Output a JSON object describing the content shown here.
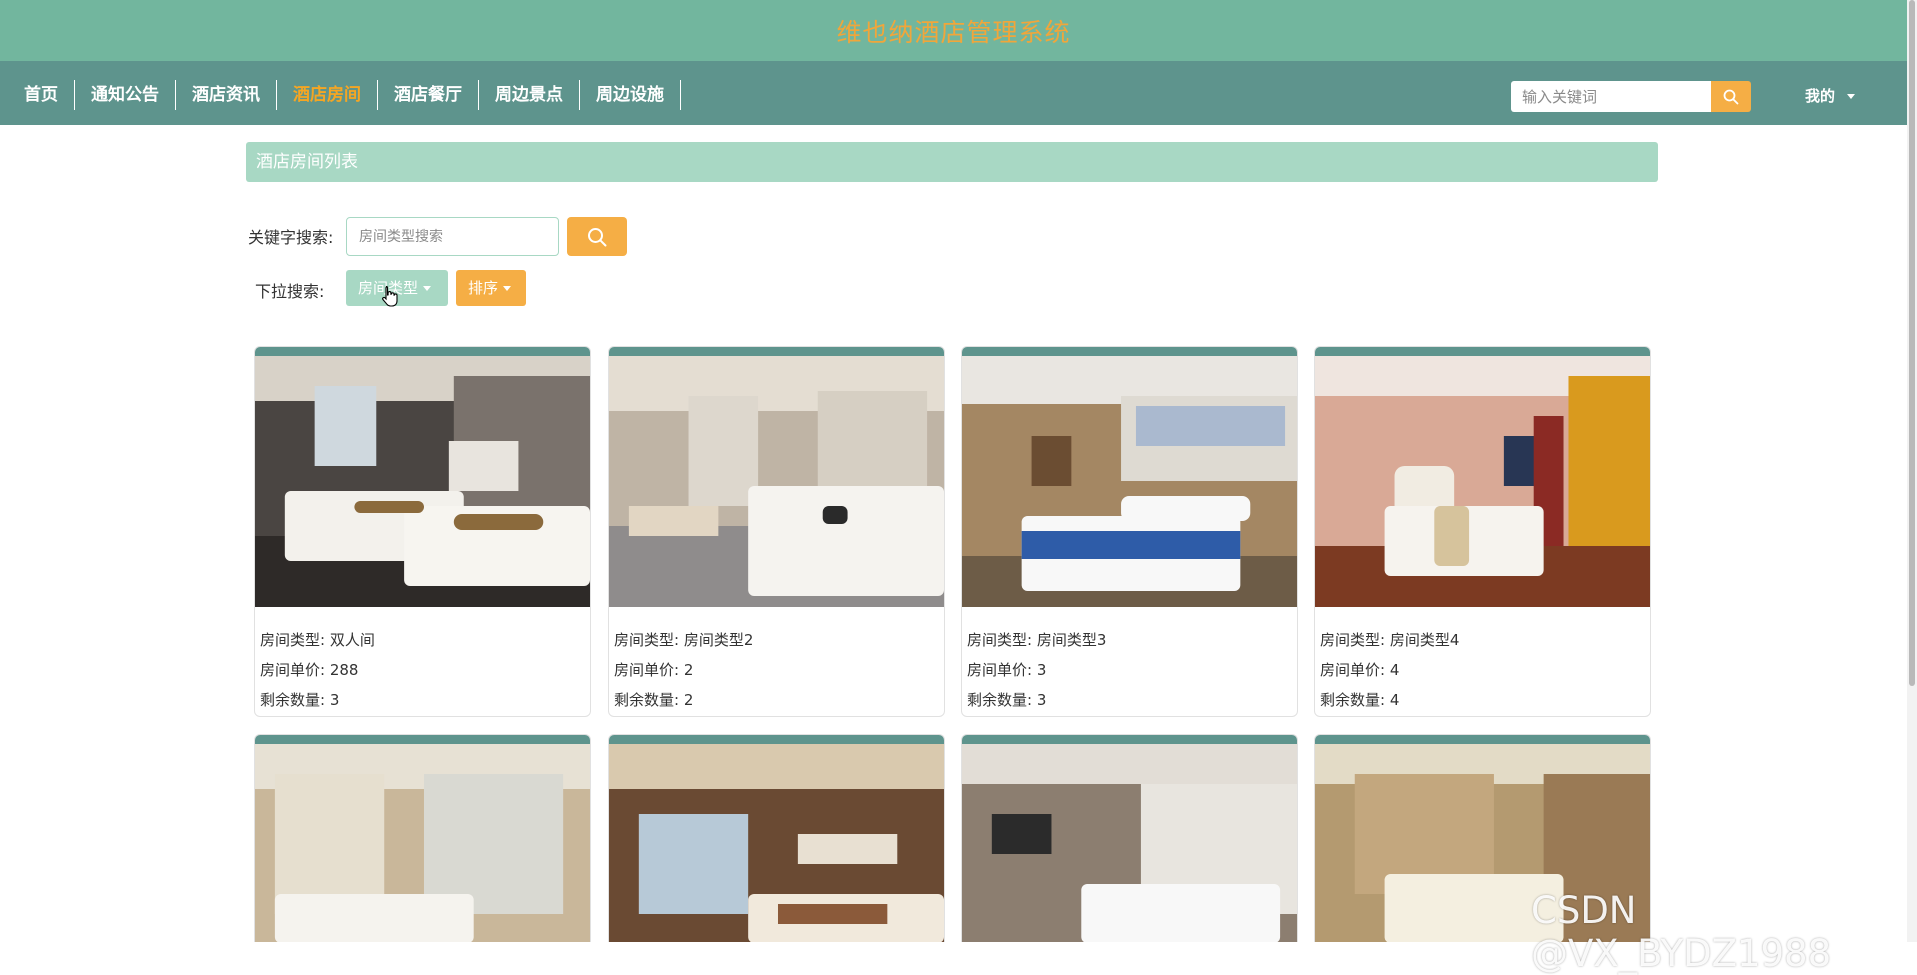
{
  "app": {
    "title": "维也纳酒店管理系统"
  },
  "nav": {
    "items": [
      {
        "label": "首页",
        "active": false
      },
      {
        "label": "通知公告",
        "active": false
      },
      {
        "label": "酒店资讯",
        "active": false
      },
      {
        "label": "酒店房间",
        "active": true
      },
      {
        "label": "酒店餐厅",
        "active": false
      },
      {
        "label": "周边景点",
        "active": false
      },
      {
        "label": "周边设施",
        "active": false
      }
    ],
    "search_placeholder": "输入关键词",
    "me_label": "我的"
  },
  "section": {
    "title": "酒店房间列表"
  },
  "filters": {
    "keyword_label": "关键字搜索:",
    "keyword_placeholder": "房间类型搜索",
    "dropdown_label": "下拉搜索:",
    "type_button": "房间类型",
    "sort_button": "排序"
  },
  "cards": [
    {
      "type_label": "房间类型:",
      "type": "双人间",
      "price_label": "房间单价:",
      "price": "288",
      "count_label": "剩余数量:",
      "count": "3"
    },
    {
      "type_label": "房间类型:",
      "type": "房间类型2",
      "price_label": "房间单价:",
      "price": "2",
      "count_label": "剩余数量:",
      "count": "2"
    },
    {
      "type_label": "房间类型:",
      "type": "房间类型3",
      "price_label": "房间单价:",
      "price": "3",
      "count_label": "剩余数量:",
      "count": "3"
    },
    {
      "type_label": "房间类型:",
      "type": "房间类型4",
      "price_label": "房间单价:",
      "price": "4",
      "count_label": "剩余数量:",
      "count": "4"
    }
  ],
  "watermark": "CSDN @VX_BYDZ1988",
  "colors": {
    "header_green": "#72b69e",
    "nav_teal": "#5e948d",
    "accent_orange": "#f5ae45",
    "light_green": "#a8d8c4",
    "title_orange": "#f0a63b"
  },
  "icons": {
    "nav_search": "search-icon",
    "filter_search": "search-icon",
    "dropdown": "caret-down-icon"
  }
}
